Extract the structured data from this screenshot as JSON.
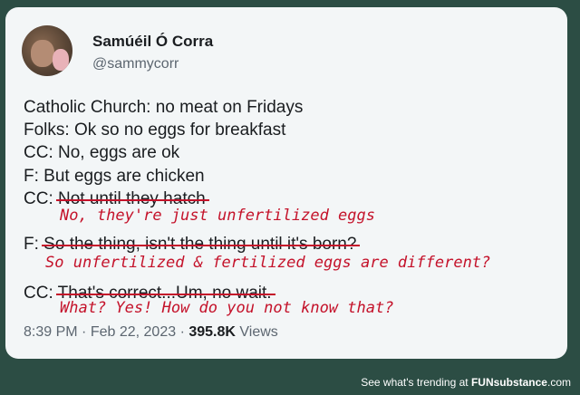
{
  "tweet": {
    "author_name": "Samúéil Ó Corra",
    "handle": "@sammycorr",
    "lines": {
      "l1": "Catholic Church: no meat on Fridays",
      "l2": "Folks: Ok so no eggs for breakfast",
      "l3": "CC: No, eggs are ok",
      "l4": "F: But eggs are chicken",
      "l5_prefix": "CC:",
      "l5_struck": "Not until they hatch",
      "l6_prefix": "F:",
      "l6_struck": "So the thing, isn't the thing until it's born?",
      "l7_prefix": "CC:",
      "l7_struck": "That's correct...Um, no wait."
    },
    "handwritten": {
      "h1": "No, they're just unfertilized eggs",
      "h2": "So unfertilized & fertilized eggs are different?",
      "h3": "What? Yes! How do you not know that?"
    },
    "time": "8:39 PM",
    "date": "Feb 22, 2023",
    "views_count": "395.8K",
    "views_label": "Views"
  },
  "footer": {
    "text": "See what's trending at",
    "brand_fun": "FUN",
    "brand_sub": "substance",
    "brand_tld": ".com"
  },
  "colors": {
    "background": "#2c4d44",
    "card": "#f3f6f7",
    "annotation_red": "#c4122a"
  }
}
